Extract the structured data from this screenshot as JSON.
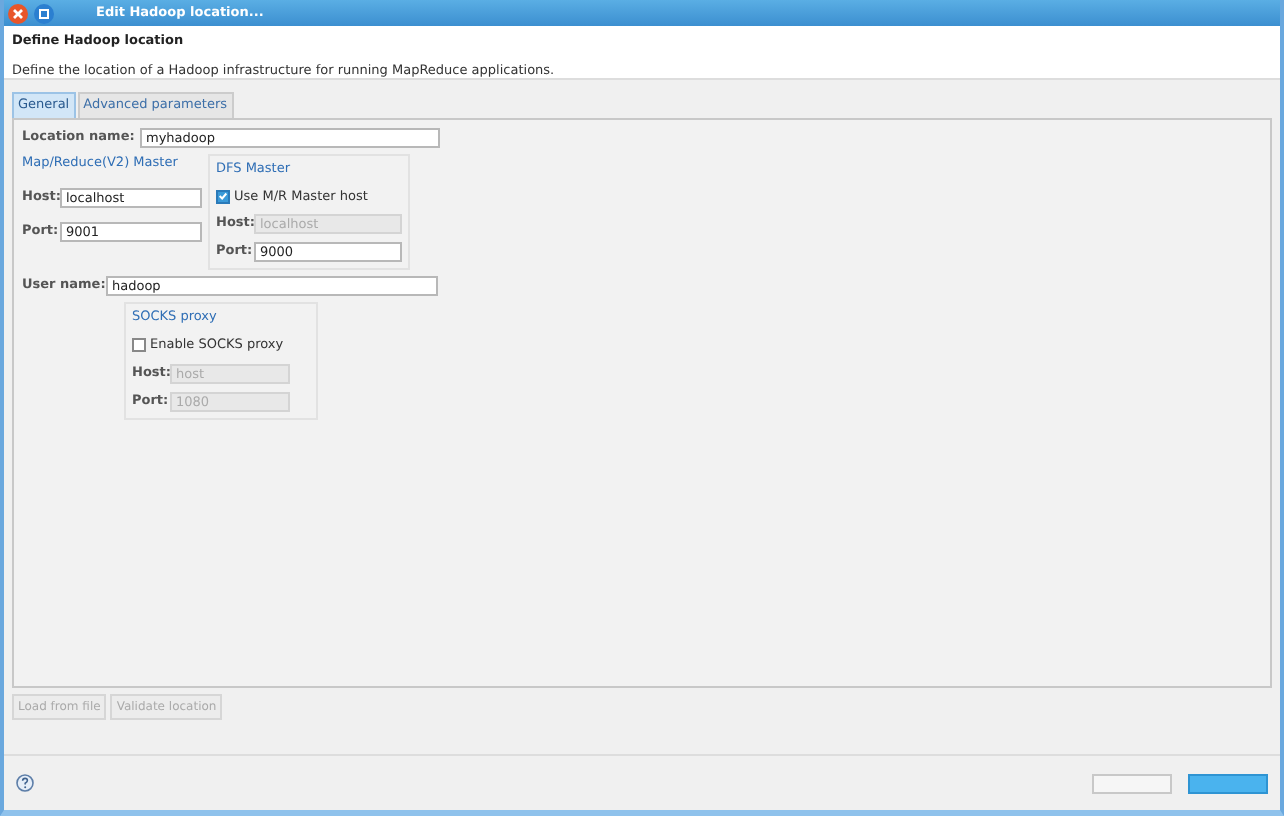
{
  "window": {
    "title": "Edit Hadoop location..."
  },
  "header": {
    "title": "Define Hadoop location",
    "description": "Define the location of a Hadoop infrastructure for running MapReduce applications."
  },
  "tabs": [
    {
      "label": "General",
      "selected": true
    },
    {
      "label": "Advanced parameters",
      "selected": false
    }
  ],
  "location_name": {
    "label": "Location name:",
    "value": "myhadoop"
  },
  "mr_master": {
    "title": "Map/Reduce(V2) Master",
    "fields": [
      {
        "label": "Host:",
        "value": "localhost",
        "disabled": false
      },
      {
        "label": "Port:",
        "value": "9001",
        "disabled": false
      }
    ]
  },
  "dfs_master": {
    "title": "DFS Master",
    "checkbox": {
      "label": "Use M/R Master host",
      "checked": true
    },
    "fields": [
      {
        "label": "Host:",
        "value": "localhost",
        "disabled": true
      },
      {
        "label": "Port:",
        "value": "9000",
        "disabled": false
      }
    ]
  },
  "user_name": {
    "label": "User name:",
    "value": "hadoop"
  },
  "socks_proxy": {
    "title": "SOCKS proxy",
    "checkbox": {
      "label": "Enable SOCKS proxy",
      "checked": false
    },
    "fields": [
      {
        "label": "Host:",
        "value": "host",
        "disabled": true
      },
      {
        "label": "Port:",
        "value": "1080",
        "disabled": true
      }
    ]
  },
  "action_buttons": [
    {
      "label": "Load from file",
      "disabled": true
    },
    {
      "label": "Validate location",
      "disabled": true
    }
  ],
  "footer_buttons": [
    {
      "kind": "default"
    },
    {
      "kind": "primary"
    }
  ]
}
